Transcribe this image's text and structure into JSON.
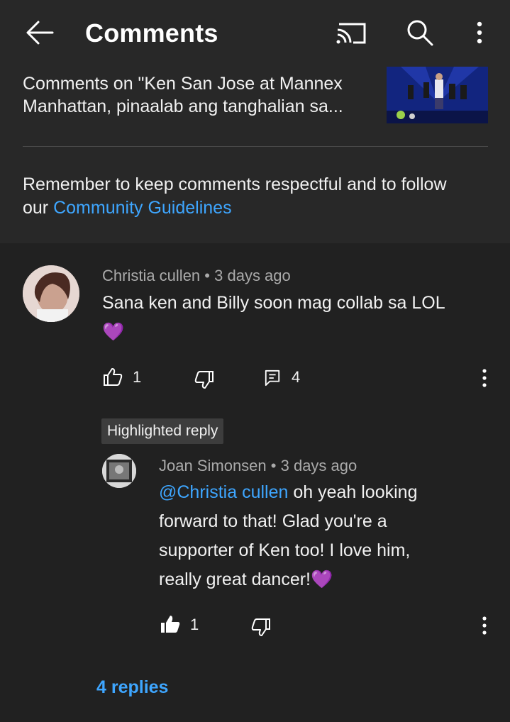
{
  "appbar": {
    "title": "Comments",
    "icons": [
      "back-arrow-icon",
      "cast-icon",
      "search-icon",
      "more-vert-icon"
    ]
  },
  "header": {
    "video_title": "Comments on \"Ken San Jose at Mannex Manhattan, pinaalab ang tanghalian sa...",
    "guidelines_text": "Remember to keep comments respectful and to follow our ",
    "guidelines_link": "Community Guidelines"
  },
  "comment": {
    "author": "Christia cullen",
    "separator": "•",
    "time": "3 days ago",
    "text": "Sana ken and Billy soon mag collab sa LOL",
    "emoji": "💜",
    "likes": "1",
    "replies_count": "4"
  },
  "highlighted_label": "Highlighted reply",
  "reply": {
    "author": "Joan Simonsen",
    "separator": "•",
    "time": "3 days ago",
    "mention": "@Christia cullen",
    "text": " oh yeah looking forward to that! Glad you're a supporter of Ken too! I love him, really great dancer!",
    "emoji": "💜",
    "likes": "1"
  },
  "replies_link": "4 replies",
  "colors": {
    "link": "#3ea6ff",
    "heart": "#9b30d9",
    "background": "#212121",
    "header_bg": "#282828"
  }
}
